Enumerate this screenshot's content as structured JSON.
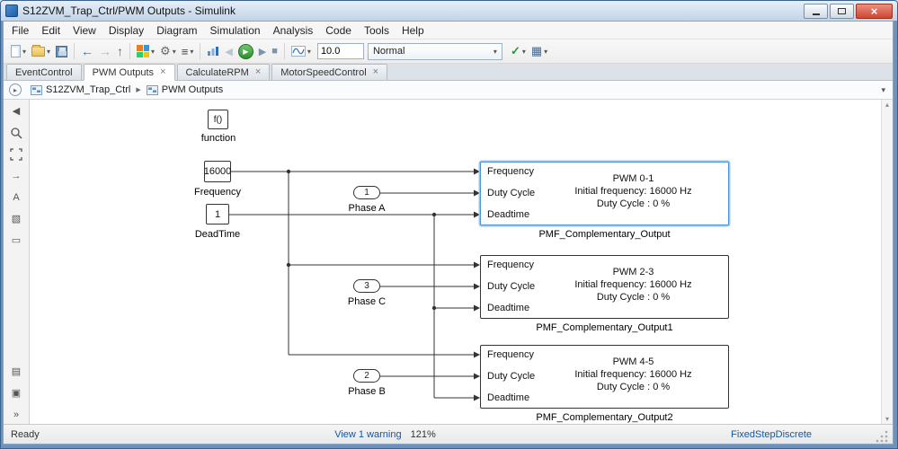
{
  "window": {
    "title": "S12ZVM_Trap_Ctrl/PWM Outputs - Simulink"
  },
  "menu": {
    "items": [
      "File",
      "Edit",
      "View",
      "Display",
      "Diagram",
      "Simulation",
      "Analysis",
      "Code",
      "Tools",
      "Help"
    ]
  },
  "toolbar": {
    "stop_time": "10.0",
    "mode": "Normal"
  },
  "tabs": [
    {
      "label": "EventControl"
    },
    {
      "label": "PWM Outputs"
    },
    {
      "label": "CalculateRPM"
    },
    {
      "label": "MotorSpeedControl"
    }
  ],
  "breadcrumb": {
    "root": "S12ZVM_Trap_Ctrl",
    "current": "PWM Outputs"
  },
  "canvas": {
    "function_block": {
      "text": "f()",
      "label": "function"
    },
    "constants": [
      {
        "value": "16000",
        "label": "Frequency"
      },
      {
        "value": "1",
        "label": "DeadTime"
      }
    ],
    "inports": [
      {
        "num": "1",
        "label": "Phase A"
      },
      {
        "num": "3",
        "label": "Phase C"
      },
      {
        "num": "2",
        "label": "Phase B"
      }
    ],
    "subsystems": [
      {
        "ports": [
          "Frequency",
          "Duty Cycle",
          "Deadtime"
        ],
        "lines": [
          "PWM 0-1",
          "Initial frequency: 16000 Hz",
          "Duty Cycle : 0 %"
        ],
        "name": "PMF_Complementary_Output"
      },
      {
        "ports": [
          "Frequency",
          "Duty Cycle",
          "Deadtime"
        ],
        "lines": [
          "PWM 2-3",
          "Initial frequency: 16000 Hz",
          "Duty Cycle : 0 %"
        ],
        "name": "PMF_Complementary_Output1"
      },
      {
        "ports": [
          "Frequency",
          "Duty Cycle",
          "Deadtime"
        ],
        "lines": [
          "PWM 4-5",
          "Initial frequency: 16000 Hz",
          "Duty Cycle : 0 %"
        ],
        "name": "PMF_Complementary_Output2"
      }
    ]
  },
  "status": {
    "ready": "Ready",
    "warning": "View 1 warning",
    "zoom": "121%",
    "solver": "FixedStepDiscrete"
  },
  "icons": {
    "caret": "▾",
    "close": "×",
    "tab_close": "×",
    "back": "←",
    "forward": "→",
    "up": "↑",
    "gear": "⚙",
    "menu": "≡",
    "run": "▶",
    "step_back": "◀",
    "step_forward": "▶",
    "stop": "■",
    "check": "✓",
    "build": "▦",
    "collapse": "◀",
    "arrow_right": "→",
    "annotation": "A",
    "image": "▧",
    "area": "▭",
    "legend": "▤",
    "viewmark": "▣",
    "more": "»",
    "crumb_sep": "▶",
    "expand": "▸",
    "scroll_up": "▴",
    "scroll_down": "▾"
  },
  "colors": {
    "accent": "#4f94d6",
    "run_green": "#2e8f2e",
    "link_blue": "#1158a7"
  }
}
